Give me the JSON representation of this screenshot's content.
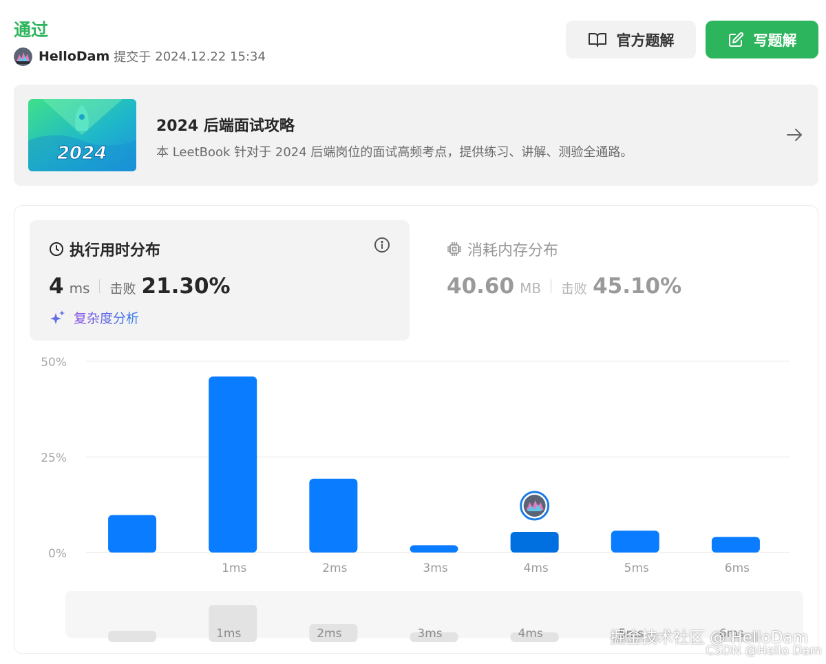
{
  "header": {
    "status": "通过",
    "username": "HelloDam",
    "submitted_label": "提交于",
    "timestamp": "2024.12.22 15:34"
  },
  "buttons": {
    "official": "官方题解",
    "write": "写题解"
  },
  "leetbook": {
    "title": "2024 后端面试攻略",
    "description": "本 LeetBook 针对于 2024 后端岗位的面试高频考点，提供练习、讲解、测验全通路。",
    "cover_text": "2024"
  },
  "runtime": {
    "label": "执行用时分布",
    "value": "4",
    "unit": "ms",
    "beat_label": "击败",
    "beat_pct": "21.30%",
    "complexity_label": "复杂度分析"
  },
  "memory": {
    "label": "消耗内存分布",
    "value": "40.60",
    "unit": "MB",
    "beat_label": "击败",
    "beat_pct": "45.10%"
  },
  "colors": {
    "accent_green": "#2db55d",
    "bar_blue": "#0a7cff",
    "bar_highlight": "#006fe0"
  },
  "chart_data": {
    "type": "bar",
    "categories": [
      "",
      "1ms",
      "2ms",
      "3ms",
      "4ms",
      "5ms",
      "6ms"
    ],
    "values": [
      9.8,
      46,
      19.3,
      1.9,
      5.4,
      5.7,
      4.1
    ],
    "highlight_index": 4,
    "ylim": [
      0,
      50
    ],
    "yticks": [
      "0%",
      "25%",
      "50%"
    ],
    "ytick_values": [
      0,
      25,
      50
    ],
    "grid": true,
    "overview_labels": [
      "",
      "1ms",
      "2ms",
      "3ms",
      "4ms",
      "5ms",
      "6ms"
    ]
  },
  "watermark": {
    "line1": "掘金技术社区 @ HelloDam",
    "line2": "CSDN @Hello Dam"
  }
}
